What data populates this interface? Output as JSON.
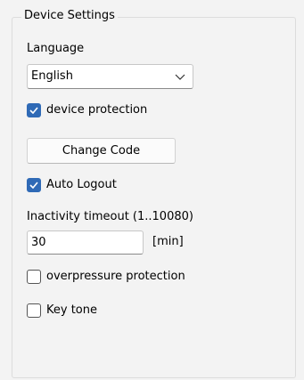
{
  "group": {
    "title": "Device Settings"
  },
  "language": {
    "label": "Language",
    "selected": "English"
  },
  "device_protection": {
    "label": "device protection",
    "checked": true
  },
  "change_code": {
    "label": "Change Code"
  },
  "auto_logout": {
    "label": "Auto Logout",
    "checked": true
  },
  "inactivity_timeout": {
    "label": "Inactivity timeout (1..10080)",
    "value": "30",
    "unit": "[min]"
  },
  "overpressure_protection": {
    "label": "overpressure protection",
    "checked": false
  },
  "key_tone": {
    "label": "Key tone",
    "checked": false
  },
  "icons": {
    "dropdown": "chevron-down-icon",
    "check": "checkmark-icon"
  },
  "colors": {
    "accent": "#2f6ab6"
  }
}
